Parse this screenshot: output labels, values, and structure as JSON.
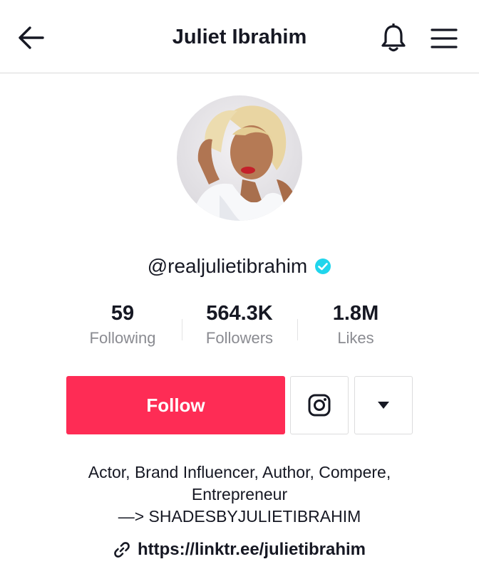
{
  "header": {
    "title": "Juliet Ibrahim",
    "back_icon": "arrow-left-icon",
    "notification_icon": "bell-icon",
    "menu_icon": "hamburger-menu-icon"
  },
  "profile": {
    "username": "@realjulietibrahim",
    "verified": true,
    "verified_color": "#20d5ec"
  },
  "stats": [
    {
      "value": "59",
      "label": "Following"
    },
    {
      "value": "564.3K",
      "label": "Followers"
    },
    {
      "value": "1.8M",
      "label": "Likes"
    }
  ],
  "actions": {
    "follow_label": "Follow",
    "follow_color": "#fe2c55",
    "instagram_icon": "instagram-icon",
    "more_icon": "caret-down-icon"
  },
  "bio": {
    "lines": [
      "Actor, Brand Influencer, Author, Compere,",
      "Entrepreneur",
      "—> SHADESBYJULIETIBRAHIM"
    ]
  },
  "link": {
    "icon": "link-icon",
    "url": "https://linktr.ee/julietibrahim"
  }
}
